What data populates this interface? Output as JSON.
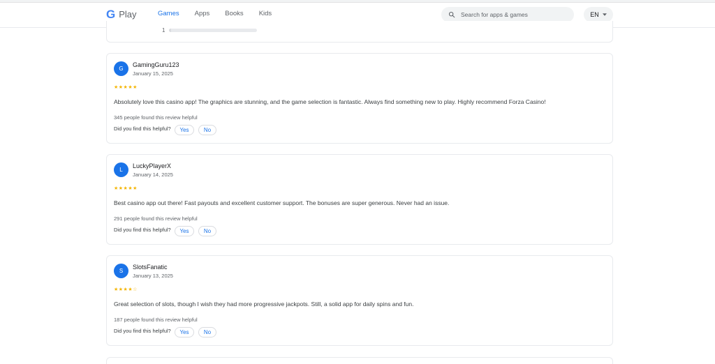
{
  "header": {
    "logo_g": "G",
    "logo_text": "Play",
    "nav": [
      "Games",
      "Apps",
      "Books",
      "Kids"
    ],
    "active_nav": "Games",
    "search_placeholder": "Search for apps & games",
    "language": "EN"
  },
  "rating_breakdown": {
    "label": "1",
    "fraction": 0.02
  },
  "reviews": [
    {
      "initial": "G",
      "name": "GamingGuru123",
      "date": "January 15, 2025",
      "stars": "★★★★★",
      "rating": 5,
      "text": "Absolutely love this casino app! The graphics are stunning, and the game selection is fantastic. Always find something new to play. Highly recommend Forza Casino!",
      "helpful_count": "345 people found this review helpful",
      "helpful_question": "Did you find this helpful?",
      "yes_label": "Yes",
      "no_label": "No"
    },
    {
      "initial": "L",
      "name": "LuckyPlayerX",
      "date": "January 14, 2025",
      "stars": "★★★★★",
      "rating": 5,
      "text": "Best casino app out there! Fast payouts and excellent customer support. The bonuses are super generous. Never had an issue.",
      "helpful_count": "291 people found this review helpful",
      "helpful_question": "Did you find this helpful?",
      "yes_label": "Yes",
      "no_label": "No"
    },
    {
      "initial": "S",
      "name": "SlotsFanatic",
      "date": "January 13, 2025",
      "stars": "★★★★☆",
      "rating": 4,
      "text": "Great selection of slots, though I wish they had more progressive jackpots. Still, a solid app for daily spins and fun.",
      "helpful_count": "187 people found this review helpful",
      "helpful_question": "Did you find this helpful?",
      "yes_label": "Yes",
      "no_label": "No"
    }
  ],
  "colors": {
    "accent": "#1a73e8",
    "star": "#f4b400",
    "border": "#e8eaed"
  },
  "icons": [
    "search-icon",
    "chevron-down-icon"
  ]
}
